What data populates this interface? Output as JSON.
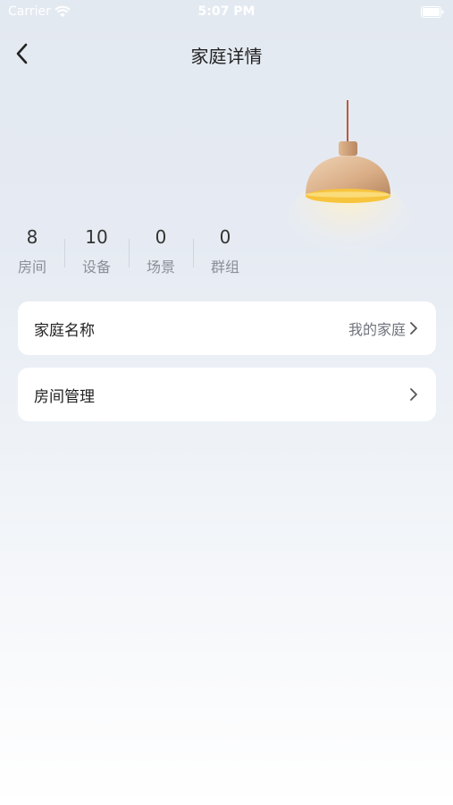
{
  "status_bar": {
    "carrier": "Carrier",
    "time": "5:07 PM"
  },
  "nav": {
    "title": "家庭详情",
    "back_icon": "chevron-left-icon"
  },
  "stats": [
    {
      "value": "8",
      "label": "房间"
    },
    {
      "value": "10",
      "label": "设备"
    },
    {
      "value": "0",
      "label": "场景"
    },
    {
      "value": "0",
      "label": "群组"
    }
  ],
  "rows": [
    {
      "label": "家庭名称",
      "value": "我的家庭",
      "icon": "chevron-right-icon"
    },
    {
      "label": "房间管理",
      "value": "",
      "icon": "chevron-right-icon"
    }
  ],
  "colors": {
    "lamp_shade": "#e0b890",
    "lamp_light": "#f7c43d",
    "lamp_cord": "#c0583a"
  }
}
